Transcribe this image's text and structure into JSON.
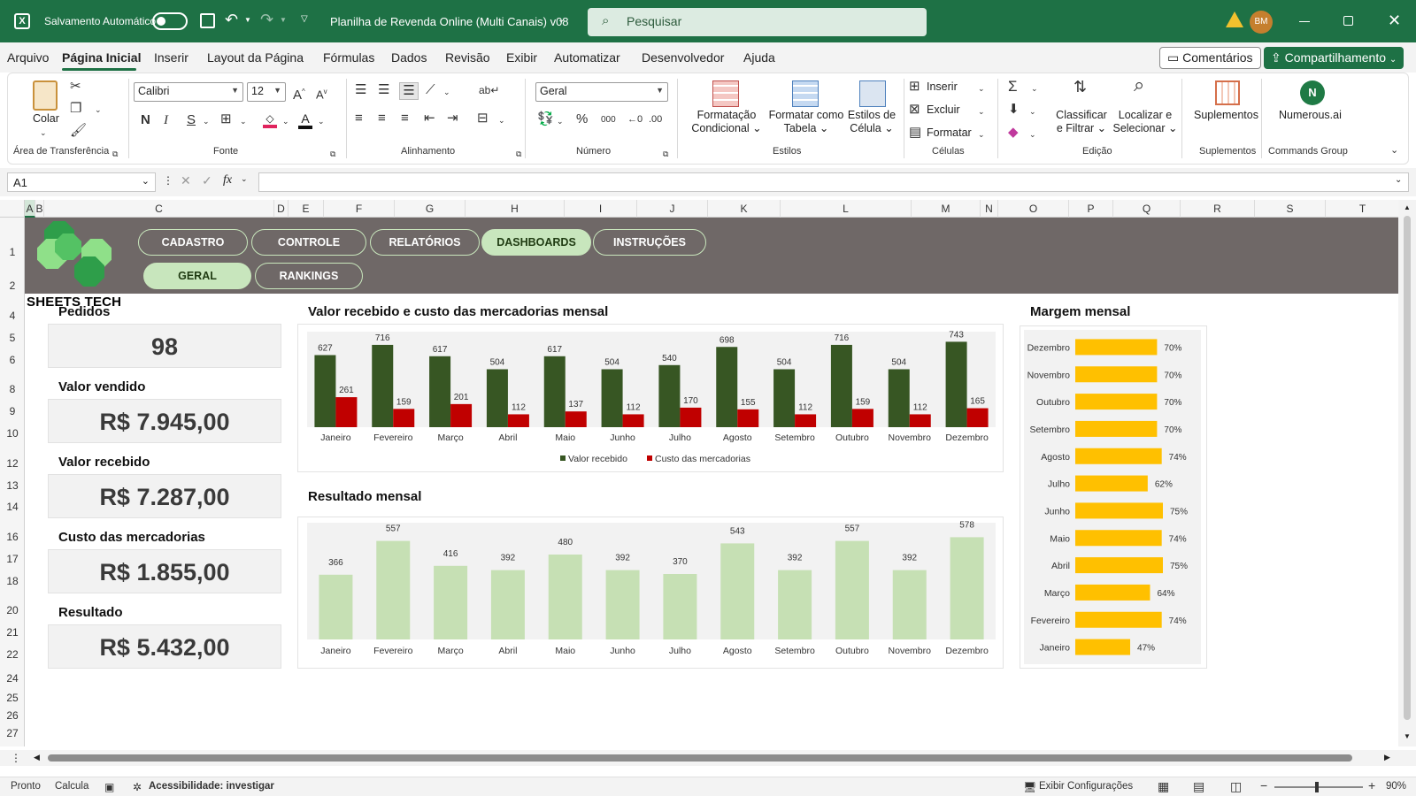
{
  "titlebar": {
    "autosave_label": "Salvamento Automático",
    "doc_title": "Planilha de Revenda Online (Multi Canais) v08",
    "search_placeholder": "Pesquisar",
    "avatar_initials": "BM"
  },
  "menu": {
    "items": [
      "Arquivo",
      "Página Inicial",
      "Inserir",
      "Layout da Página",
      "Fórmulas",
      "Dados",
      "Revisão",
      "Exibir",
      "Automatizar",
      "Desenvolvedor",
      "Ajuda"
    ],
    "active_index": 1,
    "comments_label": "Comentários",
    "share_label": "Compartilhamento"
  },
  "ribbon": {
    "clipboard": {
      "paste_label": "Colar",
      "group_label": "Área de Transferência"
    },
    "font": {
      "name": "Calibri",
      "size": "12",
      "bold": "N",
      "italic": "I",
      "underline": "S",
      "group_label": "Fonte"
    },
    "alignment": {
      "group_label": "Alinhamento"
    },
    "number": {
      "format": "Geral",
      "group_label": "Número"
    },
    "styles": {
      "cond_format": [
        "Formatação",
        "Condicional"
      ],
      "format_table": [
        "Formatar como",
        "Tabela"
      ],
      "cell_styles": [
        "Estilos de",
        "Célula"
      ],
      "group_label": "Estilos"
    },
    "cells": {
      "insert": "Inserir",
      "delete": "Excluir",
      "format": "Formatar",
      "group_label": "Células"
    },
    "editing": {
      "sort": [
        "Classificar",
        "e Filtrar"
      ],
      "find": [
        "Localizar e",
        "Selecionar"
      ],
      "group_label": "Edição"
    },
    "addins": {
      "label": "Suplementos",
      "group_label": "Suplementos"
    },
    "numerous": {
      "label": "Numerous.ai",
      "group_label": "Commands Group"
    }
  },
  "formula_bar": {
    "cell_ref": "A1",
    "fx": "fx",
    "content": ""
  },
  "columns": [
    "A",
    "B",
    "C",
    "D",
    "E",
    "F",
    "G",
    "H",
    "I",
    "J",
    "K",
    "L",
    "M",
    "N",
    "O",
    "P",
    "Q",
    "R",
    "S",
    "T"
  ],
  "rows": [
    "1",
    "2",
    "4",
    "5",
    "6",
    "8",
    "9",
    "10",
    "12",
    "13",
    "14",
    "16",
    "17",
    "18",
    "20",
    "21",
    "22",
    "24",
    "25",
    "26",
    "27"
  ],
  "sheet": {
    "brand_name": "SHEETS TECH",
    "nav_top": [
      "CADASTRO",
      "CONTROLE",
      "RELATÓRIOS",
      "DASHBOARDS",
      "INSTRUÇÕES"
    ],
    "nav_top_active": 3,
    "nav_sub": [
      "GERAL",
      "RANKINGS"
    ],
    "nav_sub_active": 0,
    "kpis": [
      {
        "label": "Pedidos",
        "value": "98"
      },
      {
        "label": "Valor vendido",
        "value": "R$ 7.945,00"
      },
      {
        "label": "Valor recebido",
        "value": "R$ 7.287,00"
      },
      {
        "label": "Custo das mercadorias",
        "value": "R$ 1.855,00"
      },
      {
        "label": "Resultado",
        "value": "R$ 5.432,00"
      }
    ]
  },
  "chart_data": [
    {
      "type": "bar",
      "title": "Valor recebido e custo das mercadorias mensal",
      "categories": [
        "Janeiro",
        "Fevereiro",
        "Março",
        "Abril",
        "Maio",
        "Junho",
        "Julho",
        "Agosto",
        "Setembro",
        "Outubro",
        "Novembro",
        "Dezembro"
      ],
      "series": [
        {
          "name": "Valor recebido",
          "color": "#375623",
          "values": [
            627,
            716,
            617,
            504,
            617,
            504,
            540,
            698,
            504,
            716,
            504,
            743
          ]
        },
        {
          "name": "Custo das mercadorias",
          "color": "#c00000",
          "values": [
            261,
            159,
            201,
            112,
            137,
            112,
            170,
            155,
            112,
            159,
            112,
            165
          ]
        }
      ],
      "legend": "bottom",
      "grid": false
    },
    {
      "type": "bar",
      "title": "Resultado mensal",
      "categories": [
        "Janeiro",
        "Fevereiro",
        "Março",
        "Abril",
        "Maio",
        "Junho",
        "Julho",
        "Agosto",
        "Setembro",
        "Outubro",
        "Novembro",
        "Dezembro"
      ],
      "series": [
        {
          "color": "#c6e0b4",
          "values": [
            366,
            557,
            416,
            392,
            480,
            392,
            370,
            543,
            392,
            557,
            392,
            578
          ]
        }
      ],
      "grid": false
    },
    {
      "type": "bar",
      "orientation": "horizontal",
      "title": "Margem mensal",
      "categories": [
        "Dezembro",
        "Novembro",
        "Outubro",
        "Setembro",
        "Agosto",
        "Julho",
        "Junho",
        "Maio",
        "Abril",
        "Março",
        "Fevereiro",
        "Janeiro"
      ],
      "series": [
        {
          "color": "#ffc000",
          "values": [
            70,
            70,
            70,
            70,
            74,
            62,
            75,
            74,
            75,
            64,
            74,
            47
          ],
          "unit": "%"
        }
      ],
      "xlim": [
        0,
        100
      ],
      "grid": false
    }
  ],
  "status": {
    "ready": "Pronto",
    "calc": "Calcula",
    "accessibility": "Acessibilidade: investigar",
    "display_settings": "Exibir Configurações",
    "zoom": "90%"
  }
}
